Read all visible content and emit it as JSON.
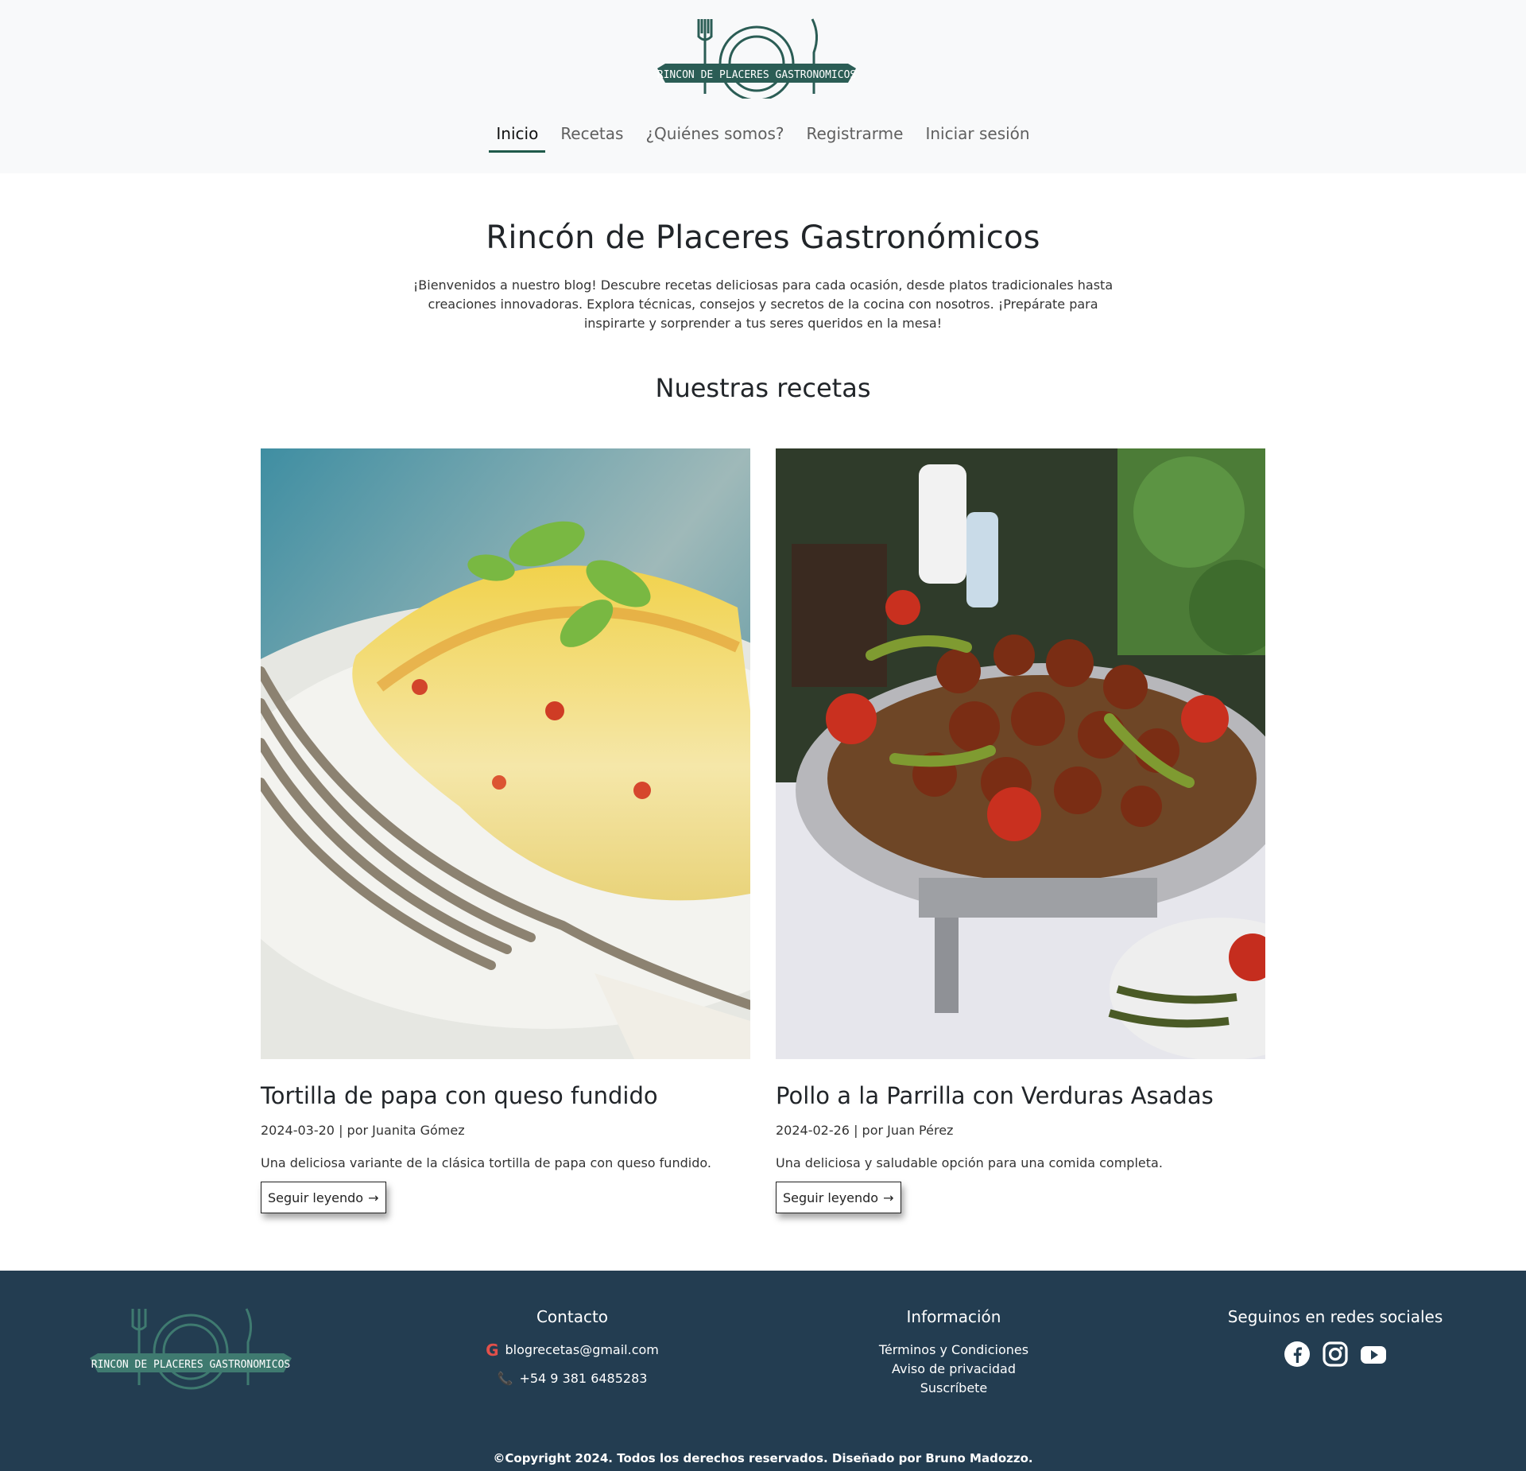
{
  "brand": {
    "logo_text": "RINCON DE PLACERES GASTRONOMICOS",
    "accent": "#2b5d55"
  },
  "nav": {
    "items": [
      {
        "label": "Inicio",
        "active": true
      },
      {
        "label": "Recetas"
      },
      {
        "label": "¿Quiénes somos?"
      },
      {
        "label": "Registrarme"
      },
      {
        "label": "Iniciar sesión"
      }
    ]
  },
  "hero": {
    "title": "Rincón de Placeres Gastronómicos",
    "intro_lines": [
      "¡Bienvenidos a nuestro blog! Descubre recetas deliciosas para cada ocasión, desde platos tradicionales hasta",
      "creaciones innovadoras. Explora técnicas, consejos y secretos de la cocina con nosotros. ¡Prepárate para",
      "inspirarte y sorprender a tus seres queridos en la mesa!"
    ]
  },
  "recipes": {
    "section_title": "Nuestras recetas",
    "cards": [
      {
        "title": "Tortilla de papa con queso fundido",
        "meta": "2024-03-20 | por Juanita Gómez",
        "desc": "Una deliciosa variante de la clásica tortilla de papa con queso fundido.",
        "button": "Seguir leyendo"
      },
      {
        "title": "Pollo a la Parrilla con Verduras Asadas",
        "meta": "2024-02-26 | por Juan Pérez",
        "desc": "Una deliciosa y saludable opción para una comida completa.",
        "button": "Seguir leyendo"
      }
    ]
  },
  "footer": {
    "bg": "#233d51",
    "contact": {
      "title": "Contacto",
      "email": "blogrecetas@gmail.com",
      "phone": "+54 9 381 6485283"
    },
    "info": {
      "title": "Información",
      "links": [
        "Términos y Condiciones",
        "Aviso de privacidad",
        "Suscríbete"
      ]
    },
    "social": {
      "title": "Seguinos en redes sociales",
      "icons": [
        "facebook-icon",
        "instagram-icon",
        "youtube-icon"
      ]
    },
    "copyright": "©Copyright 2024. Todos los derechos reservados. Diseñado por Bruno Madozzo."
  }
}
